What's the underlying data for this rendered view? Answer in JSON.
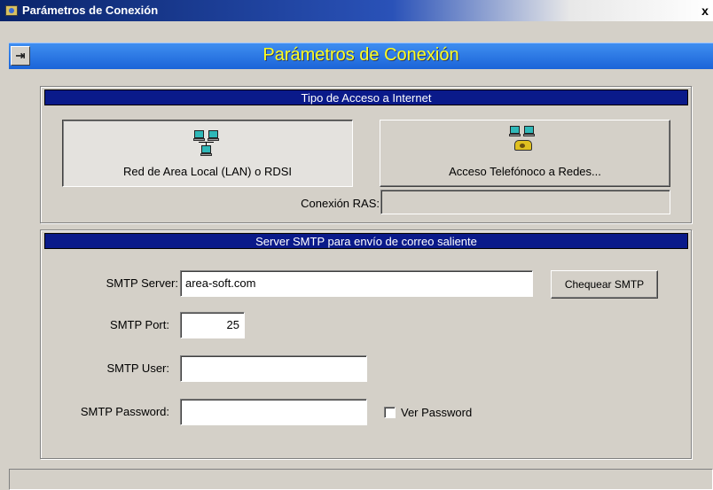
{
  "window": {
    "title": "Parámetros de Conexión",
    "close_glyph": "x"
  },
  "header": {
    "title": "Parámetros de Conexión",
    "exit_icon_glyph": "⇥"
  },
  "access_group": {
    "title": "Tipo de Acceso a Internet",
    "lan_button_label": "Red de Area Local (LAN) o RDSI",
    "dialup_button_label": "Acceso Telefónoco a Redes...",
    "ras_label": "Conexión RAS:",
    "ras_value": ""
  },
  "smtp_group": {
    "title": "Server SMTP para envío de correo saliente",
    "server_label": "SMTP Server:",
    "server_value": "area-soft.com",
    "check_button_label": "Chequear SMTP",
    "port_label": "SMTP Port:",
    "port_value": "25",
    "user_label": "SMTP User:",
    "user_value": "",
    "password_label": "SMTP Password:",
    "password_value": "",
    "show_password_label": "Ver Password",
    "show_password_checked": false
  },
  "status_bar": {
    "text": ""
  }
}
